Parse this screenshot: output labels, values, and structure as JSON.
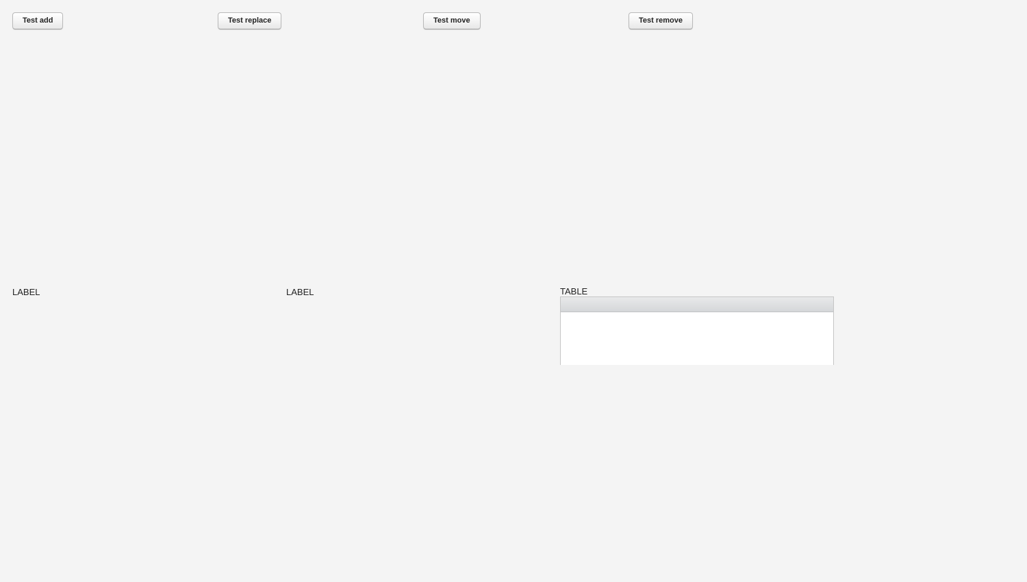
{
  "buttons": {
    "add": "Test add",
    "replace": "Test replace",
    "move": "Test move",
    "remove": "Test remove"
  },
  "labels": {
    "first": "LABEL",
    "second": "LABEL"
  },
  "table": {
    "caption": "TABLE",
    "columns": [],
    "rows": []
  }
}
